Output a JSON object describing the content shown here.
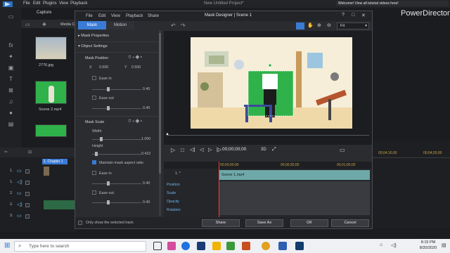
{
  "app": {
    "title": "New Untitled Project*",
    "brand": "PowerDirector",
    "menu": [
      "File",
      "Edit",
      "Plugins",
      "View",
      "Playback"
    ],
    "capture": "Capture",
    "welcome": "Welcome! View all tutorial videos here!"
  },
  "media": {
    "tab_label": "Media C",
    "items": [
      {
        "label": "2776.jpg"
      },
      {
        "label": "Scene 2.mp4"
      },
      {
        "label": ""
      }
    ]
  },
  "timeline_left": {
    "tracks": [
      "1.",
      "1.",
      "2.",
      "2.",
      "3."
    ]
  },
  "dialog": {
    "title": "Mask Designer | Scene 1",
    "menu": [
      "File",
      "Edit",
      "View",
      "Playback",
      "Share"
    ],
    "tabs": [
      "Mask",
      "Motion"
    ],
    "sections": {
      "mask_properties": "Mask Properties",
      "object_settings": "Object Settings",
      "mask_position": "Mask Position",
      "x_label": "X",
      "x_value": "0.500",
      "y_label": "Y",
      "y_value": "0.500",
      "ease_in": "Ease in",
      "ease_out": "Ease out",
      "ease_in_value": "0.40",
      "ease_out_value": "0.40",
      "mask_scale": "Mask Scale",
      "width": "Width",
      "width_value": "1.000",
      "height": "Height",
      "height_value": "0.422",
      "maintain": "Maintain mask aspect ratio",
      "ease_in2": "Ease in",
      "ease_in2_value": "0.40",
      "ease_out2": "Ease out",
      "ease_out2_value": "0.40"
    },
    "only_show": "Only show the selected track",
    "preview": {
      "fit_label": "Fit",
      "timecode": "00;00;00;00",
      "mode": "3D"
    },
    "keyframes": {
      "times": [
        "00;00;00;00",
        "00;00;30;00",
        "00;01;00;00"
      ],
      "clip_label": "Scene 1.mp4",
      "row_label": "1. *",
      "props": [
        "Position",
        "Scale",
        "Opacity",
        "Rotation"
      ]
    },
    "buttons": {
      "share": "Share",
      "save_as": "Save As",
      "ok": "OK",
      "cancel": "Cancel"
    }
  },
  "timeline_right": {
    "times": [
      "00;04;10;00",
      "00;04;20;00"
    ],
    "chapter": "1. Chapter 1"
  },
  "taskbar": {
    "search_placeholder": "Type here to search",
    "time": "8:15 PM",
    "date": "8/20/2020"
  },
  "colors": {
    "accent": "#3a7bd5",
    "green_screen": "#2fb24a",
    "dialog_bg": "#2b2c30"
  }
}
